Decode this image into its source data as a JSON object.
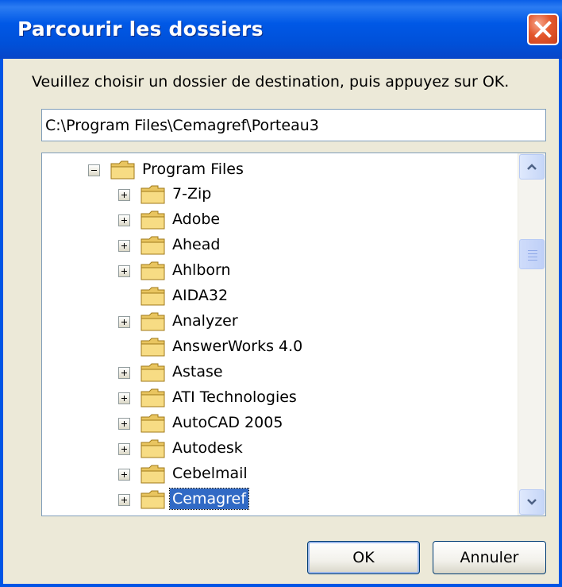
{
  "window": {
    "title": "Parcourir les dossiers",
    "close_tooltip_icon": "close-icon"
  },
  "prompt": "Veuillez choisir un dossier de destination, puis appuyez sur OK.",
  "path_value": "C:\\Program Files\\Cemagref\\Porteau3",
  "tree": {
    "root": {
      "label": "Program Files",
      "expander": "minus"
    },
    "children": [
      {
        "label": "7-Zip",
        "expander": "plus"
      },
      {
        "label": "Adobe",
        "expander": "plus"
      },
      {
        "label": "Ahead",
        "expander": "plus"
      },
      {
        "label": "Ahlborn",
        "expander": "plus"
      },
      {
        "label": "AIDA32",
        "expander": "none"
      },
      {
        "label": "Analyzer",
        "expander": "plus"
      },
      {
        "label": "AnswerWorks 4.0",
        "expander": "none"
      },
      {
        "label": "Astase",
        "expander": "plus"
      },
      {
        "label": "ATI Technologies",
        "expander": "plus"
      },
      {
        "label": "AutoCAD 2005",
        "expander": "plus"
      },
      {
        "label": "Autodesk",
        "expander": "plus"
      },
      {
        "label": "Cebelmail",
        "expander": "plus"
      },
      {
        "label": "Cemagref",
        "expander": "plus",
        "selected": true
      }
    ]
  },
  "buttons": {
    "ok": "OK",
    "cancel": "Annuler"
  },
  "colors": {
    "titlebar": "#0058e6",
    "selection": "#316ac5",
    "dialog": "#ece9d8",
    "close": "#e4572c"
  }
}
